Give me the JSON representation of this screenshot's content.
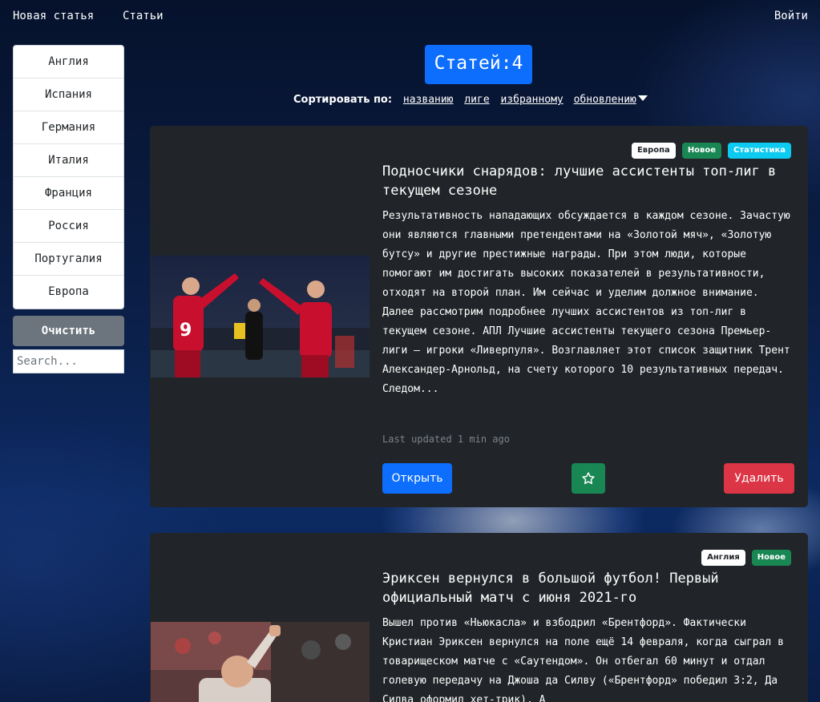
{
  "navbar": {
    "new_article": "Новая статья",
    "articles": "Статьи",
    "login": "Войти"
  },
  "sidebar": {
    "items": [
      {
        "label": "Англия"
      },
      {
        "label": "Испания"
      },
      {
        "label": "Германия"
      },
      {
        "label": "Италия"
      },
      {
        "label": "Франция"
      },
      {
        "label": "Россия"
      },
      {
        "label": "Португалия"
      },
      {
        "label": "Европа"
      }
    ],
    "clear_label": "Очистить",
    "search_placeholder": "Search..."
  },
  "header": {
    "count_text": "Статей:4",
    "sort_label": "Сортировать по:",
    "sort_options": [
      "названию",
      "лиге",
      "избранному",
      "обновлению"
    ]
  },
  "articles": [
    {
      "badges": [
        "Европа",
        "Новое",
        "Статистика"
      ],
      "title": "Подносчики снарядов: лучшие ассистенты топ-лиг в текущем сезоне",
      "excerpt": "Результативность нападающих обсуждается в каждом сезоне. Зачастую они являются главными претендентами на «Золотой мяч», «Золотую бутсу» и другие престижные награды. При этом люди, которые помогают им достигать высоких показателей в результативности, отходят на второй план. Им сейчас и уделим должное внимание. Далее рассмотрим подробнее лучших ассистентов из топ-лиг в текущем сезоне. АПЛ Лучшие ассистенты текущего сезона Премьер-лиги – игроки «Ливерпуля». Возглавляет этот список защитник Трент Александер-Арнольд, на счету которого 10 результативных передач. Следом...",
      "updated": "Last updated 1 min ago",
      "open_label": "Открыть",
      "delete_label": "Удалить",
      "jersey_number": "9"
    },
    {
      "badges": [
        "Англия",
        "Новое"
      ],
      "title": "Эриксен вернулся в большой футбол! Первый официальный матч с июня 2021-го",
      "excerpt": "Вышел против «Ньюкасла» и взбодрил «Брентфорд». Фактически Кристиан Эриксен вернулся на поле ещё 14 февраля, когда сыграл в товарищеском матче с «Саутендом». Он отбегал 60 минут и отдал голевую передачу на Джоша да Силву («Брентфорд» победил 3:2, Да Силва оформил хет-трик). А"
    }
  ]
}
